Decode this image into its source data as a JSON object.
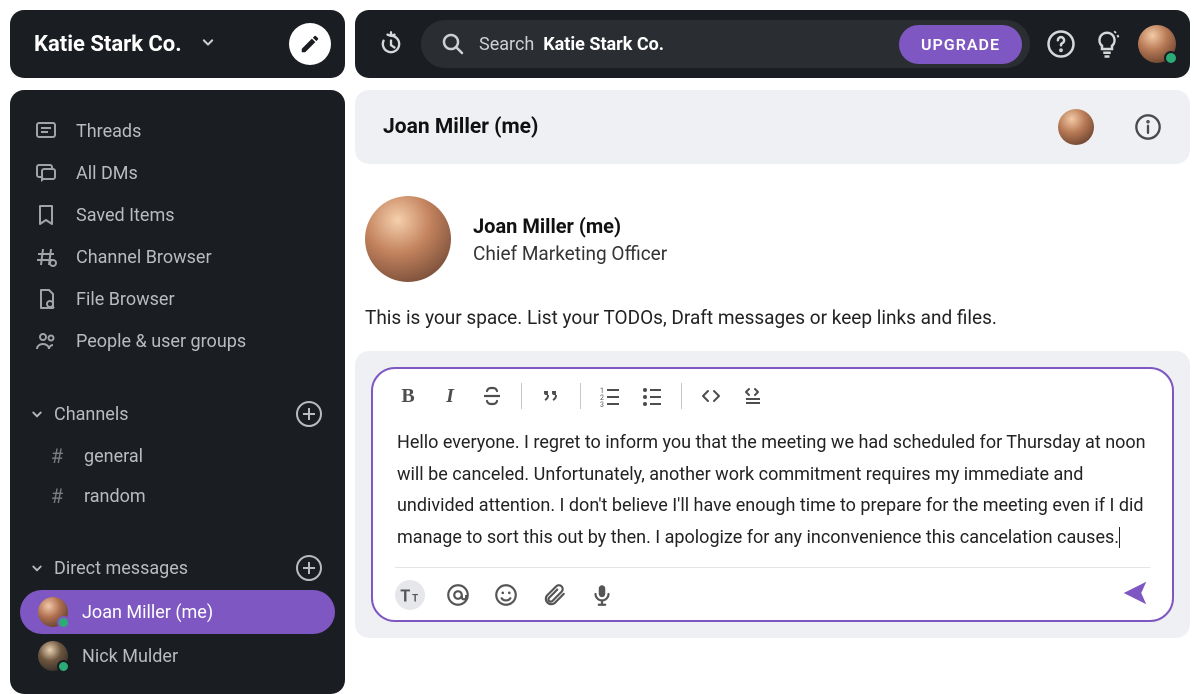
{
  "workspace": {
    "name": "Katie Stark Co."
  },
  "sidebar": {
    "nav": [
      {
        "label": "Threads",
        "icon": "threads-icon"
      },
      {
        "label": "All DMs",
        "icon": "dms-icon"
      },
      {
        "label": "Saved Items",
        "icon": "bookmark-icon"
      },
      {
        "label": "Channel Browser",
        "icon": "channel-browser-icon"
      },
      {
        "label": "File Browser",
        "icon": "file-browser-icon"
      },
      {
        "label": "People & user groups",
        "icon": "people-icon"
      }
    ],
    "channels_header": "Channels",
    "channels": [
      {
        "name": "general"
      },
      {
        "name": "random"
      }
    ],
    "dms_header": "Direct messages",
    "dms": [
      {
        "name": "Joan Miller (me)",
        "active": true,
        "presence": "online"
      },
      {
        "name": "Nick Mulder",
        "active": false,
        "presence": "online"
      }
    ]
  },
  "topbar": {
    "search_prefix": "Search",
    "search_scope": "Katie Stark Co.",
    "upgrade": "UPGRADE"
  },
  "conversation": {
    "title": "Joan Miller (me)",
    "profile_name": "Joan Miller (me)",
    "profile_title": "Chief Marketing Officer",
    "space_description": "This is your space. List your TODOs, Draft messages or keep links and files."
  },
  "composer": {
    "text": "Hello everyone. I regret to inform you that the meeting we had scheduled for Thursday at noon will be canceled. Unfortunately, another work commitment requires my immediate and undivided attention. I don't believe I'll have enough time to prepare for the meeting even if I did manage to sort this out by then. I apologize for any inconvenience this cancelation causes."
  },
  "colors": {
    "accent": "#7E57C2",
    "presence_online": "#2BAC76"
  }
}
